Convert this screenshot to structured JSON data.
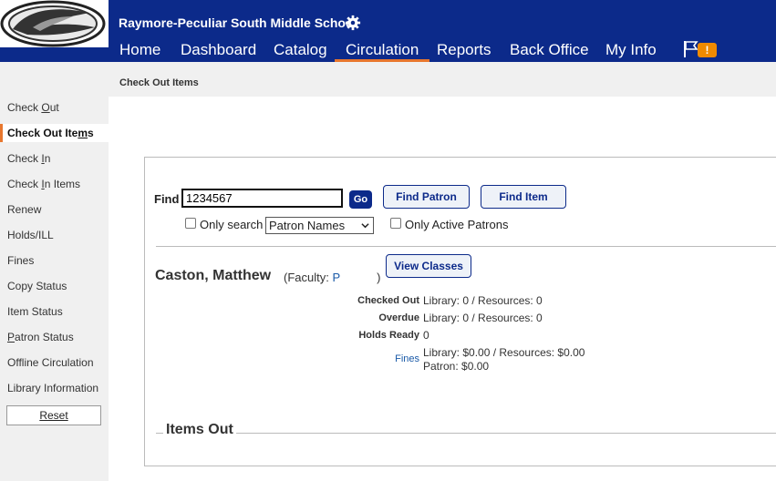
{
  "header": {
    "school_name": "Raymore-Peculiar South Middle School",
    "alert_count": "!",
    "accent_color": "#e8772e",
    "brand_color": "#0c2a8a"
  },
  "nav": {
    "items": [
      "Home",
      "Dashboard",
      "Catalog",
      "Circulation",
      "Reports",
      "Back Office",
      "My Info"
    ],
    "active": "Circulation"
  },
  "breadcrumb": "Check Out Items",
  "sidebar": {
    "items": [
      {
        "pre": "Check ",
        "u": "O",
        "post": "ut"
      },
      {
        "pre": "Check Out Ite",
        "u": "m",
        "post": "s"
      },
      {
        "pre": "Check ",
        "u": "I",
        "post": "n"
      },
      {
        "pre": "Check ",
        "u": "I",
        "post": "n Items"
      },
      {
        "pre": "Renew",
        "u": "",
        "post": ""
      },
      {
        "pre": "Holds/ILL",
        "u": "",
        "post": ""
      },
      {
        "pre": "Fines",
        "u": "",
        "post": ""
      },
      {
        "pre": "Copy Status",
        "u": "",
        "post": ""
      },
      {
        "pre": "Item Status",
        "u": "",
        "post": ""
      },
      {
        "pre": "",
        "u": "P",
        "post": "atron Status"
      },
      {
        "pre": "Offline Circulation",
        "u": "",
        "post": ""
      },
      {
        "pre": "Library Information",
        "u": "",
        "post": ""
      }
    ],
    "active_index": 1,
    "reset_label": "Reset"
  },
  "find": {
    "label": "Find",
    "value": "1234567",
    "go_label": "Go",
    "find_patron_label": "Find Patron",
    "find_item_label": "Find Item",
    "only_search_label": "Only search",
    "scope_selected": "Patron Names",
    "only_active_label": "Only Active Patrons"
  },
  "patron": {
    "name": "Caston, Matthew",
    "type_prefix": "(Faculty: ",
    "type_link": "P",
    "type_suffix": ")",
    "view_classes_label": "View Classes",
    "stats": {
      "checked_out_label": "Checked Out",
      "checked_out_value": "Library: 0 / Resources: 0",
      "overdue_label": "Overdue",
      "overdue_value": "Library: 0 / Resources: 0",
      "holds_ready_label": "Holds Ready",
      "holds_ready_value": "0",
      "fines_label": "Fines",
      "fines_value_1": "Library: $0.00 / Resources: $0.00",
      "fines_value_2": "Patron: $0.00"
    }
  },
  "items_out_title": "Items Out"
}
